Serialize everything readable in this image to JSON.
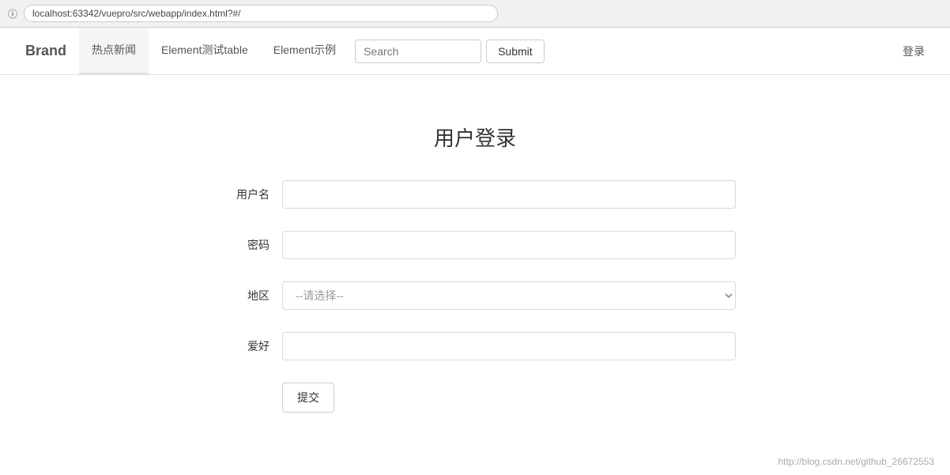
{
  "browser": {
    "url": "localhost:63342/vuepro/src/webapp/index.html?#/"
  },
  "navbar": {
    "brand": "Brand",
    "nav_items": [
      {
        "label": "热点新闻",
        "active": true
      },
      {
        "label": "Element测试table",
        "active": false
      },
      {
        "label": "Element示例",
        "active": false
      }
    ],
    "search_placeholder": "Search",
    "submit_label": "Submit",
    "login_label": "登录"
  },
  "form": {
    "title": "用户登录",
    "fields": [
      {
        "label": "用户名",
        "type": "text",
        "placeholder": ""
      },
      {
        "label": "密码",
        "type": "password",
        "placeholder": ""
      },
      {
        "label": "地区",
        "type": "select",
        "placeholder": "--请选择--"
      },
      {
        "label": "爱好",
        "type": "text",
        "placeholder": ""
      }
    ],
    "submit_label": "提交"
  },
  "footer": {
    "text": "http://blog.csdn.net/github_26672553"
  }
}
